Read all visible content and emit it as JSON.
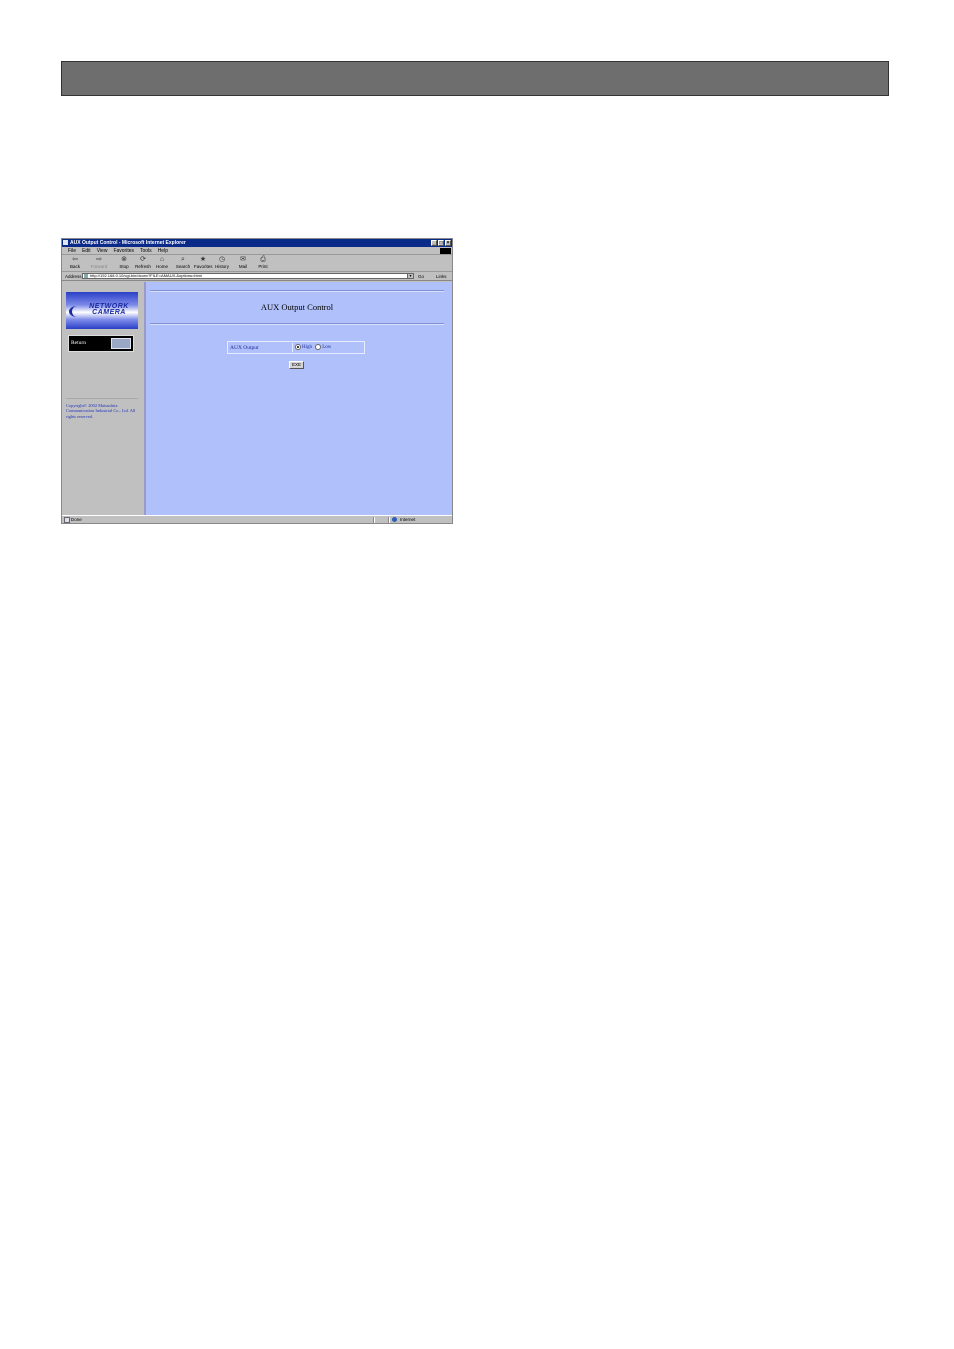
{
  "colors": {
    "header_bar": "#6e6e6e",
    "content_bg": "#b0c0fa",
    "titlebar": "#0a2a8a",
    "link_text": "#2233bb"
  },
  "window": {
    "title": "AUX Output Control - Microsoft Internet Explorer",
    "controls": {
      "minimize": "_",
      "maximize": "□",
      "close": "×"
    }
  },
  "menu": [
    "File",
    "Edit",
    "View",
    "Favorites",
    "Tools",
    "Help"
  ],
  "toolbar": [
    {
      "label": "Back",
      "icon": "back-arrow-icon",
      "glyph": "⇦"
    },
    {
      "label": "Forward",
      "icon": "forward-arrow-icon",
      "glyph": "⇨",
      "disabled": true
    },
    {
      "label": "Stop",
      "icon": "stop-icon",
      "glyph": "⊗"
    },
    {
      "label": "Refresh",
      "icon": "refresh-icon",
      "glyph": "⟳"
    },
    {
      "label": "Home",
      "icon": "home-icon",
      "glyph": "⌂"
    },
    {
      "label": "Search",
      "icon": "search-icon",
      "glyph": "⌕"
    },
    {
      "label": "Favorites",
      "icon": "favorites-icon",
      "glyph": "★"
    },
    {
      "label": "History",
      "icon": "history-icon",
      "glyph": "◷"
    },
    {
      "label": "Mail",
      "icon": "mail-icon",
      "glyph": "✉"
    },
    {
      "label": "Print",
      "icon": "print-icon",
      "glyph": "⎙"
    }
  ],
  "address": {
    "label": "Address",
    "url": "http://192.168.0.10/cgi-bin/dconv?FILE=AMAUX.&options=html",
    "go": "Go",
    "links": "Links"
  },
  "sidebar": {
    "logo_line1": "NETWORK",
    "logo_line2": "CAMERA",
    "return_label": "Return",
    "copyright": "Copyright© 2002 Matsushita Communication Industrial Co., Ltd. All rights reserved."
  },
  "main": {
    "title": "AUX Output Control",
    "aux_label": "AUX Output",
    "options": [
      {
        "label": "High",
        "selected": true
      },
      {
        "label": "Low",
        "selected": false
      }
    ],
    "exe_label": "EXE"
  },
  "status": {
    "text": "Done",
    "zone": "Internet"
  }
}
